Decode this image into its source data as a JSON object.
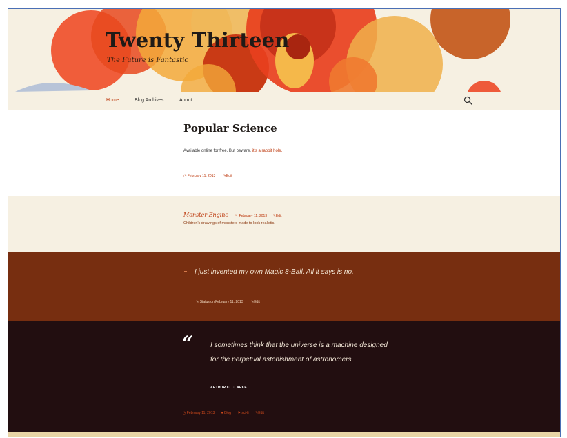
{
  "site": {
    "title": "Twenty Thirteen",
    "tagline": "The Future is Fantastic"
  },
  "nav": {
    "items": [
      {
        "label": "Home",
        "active": true
      },
      {
        "label": "Blog Archives",
        "active": false
      },
      {
        "label": "About",
        "active": false
      }
    ],
    "search_icon": "search-icon"
  },
  "posts": {
    "standard": {
      "title": "Popular Science",
      "excerpt": "Available online for free. But beware,",
      "excerpt_link": "it's a rabbit hole.",
      "date": "February 11, 2013",
      "edit": "Edit"
    },
    "link": {
      "title": "Monster Engine",
      "date": "February 11, 2013",
      "edit": "Edit",
      "description": "Children's drawings of monsters made to look realistic."
    },
    "status": {
      "text": "I just invented my own Magic 8-Ball. All it says is no.",
      "meta": "Status on February 11, 2013",
      "edit": "Edit"
    },
    "quote": {
      "mark": "“",
      "text": "I sometimes think that the universe is a machine designed for the perpetual astonishment of astronomers.",
      "cite": "ARTHUR C. CLARKE",
      "date": "February 11, 2013",
      "author": "Blog",
      "tag": "sci-fi",
      "edit": "Edit"
    }
  },
  "colors": {
    "accent": "#bc360a",
    "header_bg": "#f6f0e2",
    "status_bg": "#772e10",
    "quote_bg": "#220e10",
    "footer_bg": "#e8d5a6"
  }
}
